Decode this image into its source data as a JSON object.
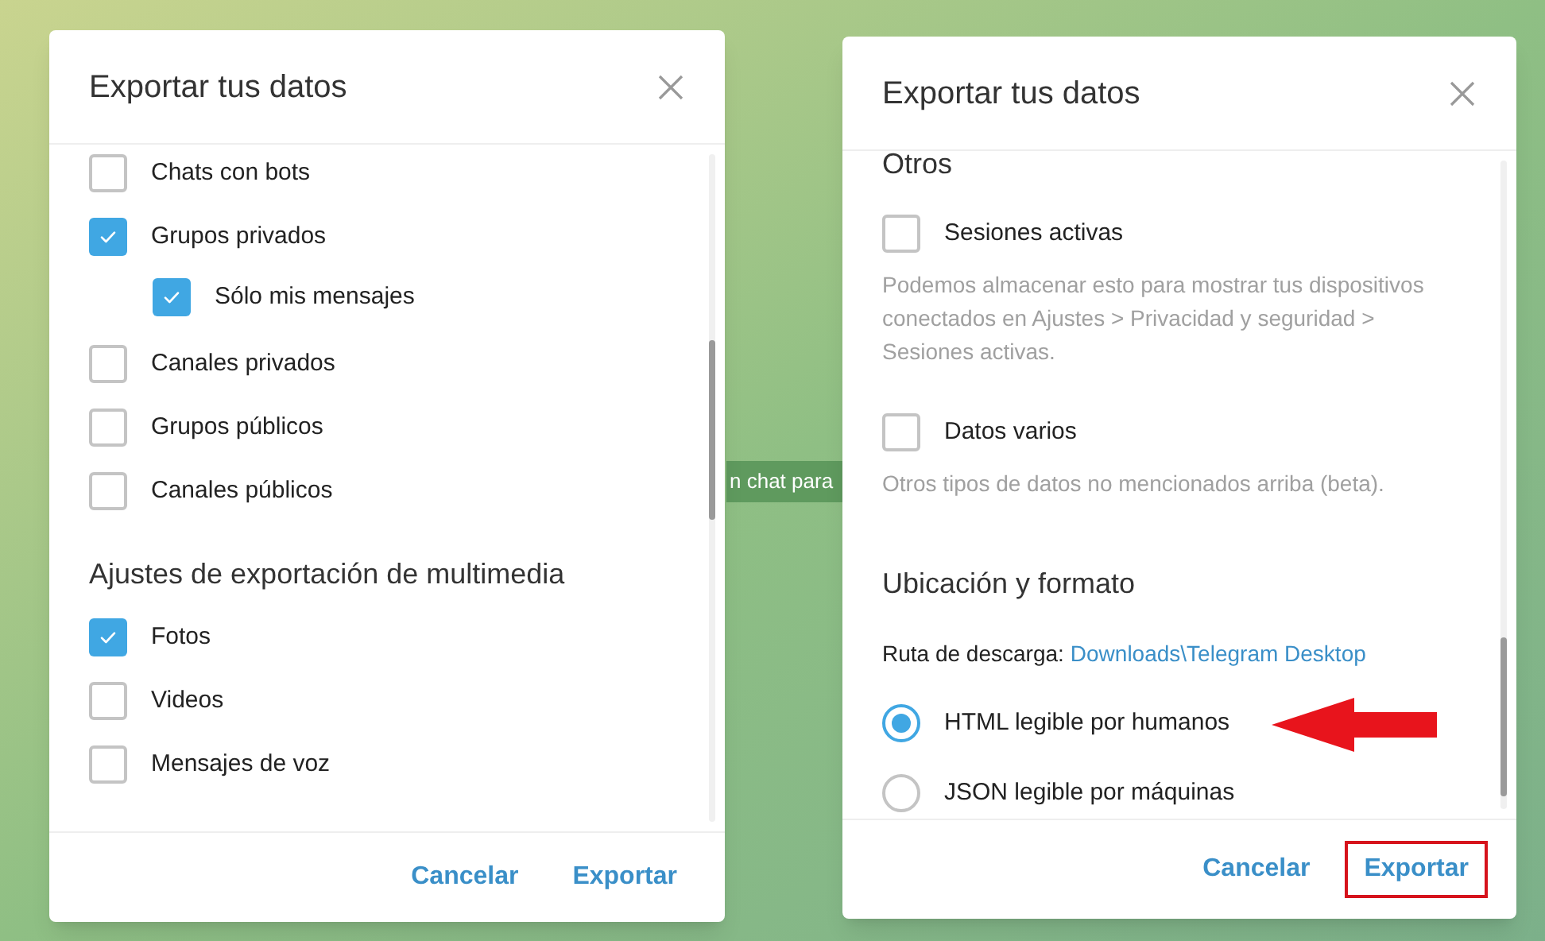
{
  "background_badge": {
    "text": "n chat para"
  },
  "dialogs": [
    {
      "title": "Exportar tus datos",
      "items": [
        {
          "kind": "checkbox",
          "label": "Chats con bots",
          "checked": false
        },
        {
          "kind": "checkbox",
          "label": "Grupos privados",
          "checked": true,
          "children": [
            {
              "kind": "checkbox",
              "label": "Sólo mis mensajes",
              "checked": true
            }
          ]
        },
        {
          "kind": "checkbox",
          "label": "Canales privados",
          "checked": false
        },
        {
          "kind": "checkbox",
          "label": "Grupos públicos",
          "checked": false
        },
        {
          "kind": "checkbox",
          "label": "Canales públicos",
          "checked": false
        },
        {
          "kind": "heading",
          "label": "Ajustes de exportación de multimedia"
        },
        {
          "kind": "checkbox",
          "label": "Fotos",
          "checked": true
        },
        {
          "kind": "checkbox",
          "label": "Videos",
          "checked": false
        },
        {
          "kind": "checkbox",
          "label": "Mensajes de voz",
          "checked": false
        }
      ],
      "buttons": [
        {
          "label": "Cancelar",
          "outlined": false
        },
        {
          "label": "Exportar",
          "outlined": false
        }
      ]
    },
    {
      "title": "Exportar tus datos",
      "items": [
        {
          "kind": "heading",
          "label": "Otros"
        },
        {
          "kind": "checkbox",
          "label": "Sesiones activas",
          "checked": false,
          "hint": "Podemos almacenar esto para mostrar tus dispositivos conectados en Ajustes > Privacidad y seguridad > Sesiones activas."
        },
        {
          "kind": "checkbox",
          "label": "Datos varios",
          "checked": false,
          "hint": "Otros tipos de datos no mencionados arriba (beta)."
        },
        {
          "kind": "heading",
          "label": "Ubicación y formato"
        },
        {
          "kind": "path",
          "label": "Ruta de descarga:",
          "link": "Downloads\\Telegram Desktop"
        },
        {
          "kind": "radio",
          "label": "HTML legible por humanos",
          "selected": true,
          "annotated": true
        },
        {
          "kind": "radio",
          "label": "JSON legible por máquinas",
          "selected": false,
          "annotated": false
        }
      ],
      "buttons": [
        {
          "label": "Cancelar",
          "outlined": false
        },
        {
          "label": "Exportar",
          "outlined": true
        }
      ]
    }
  ]
}
